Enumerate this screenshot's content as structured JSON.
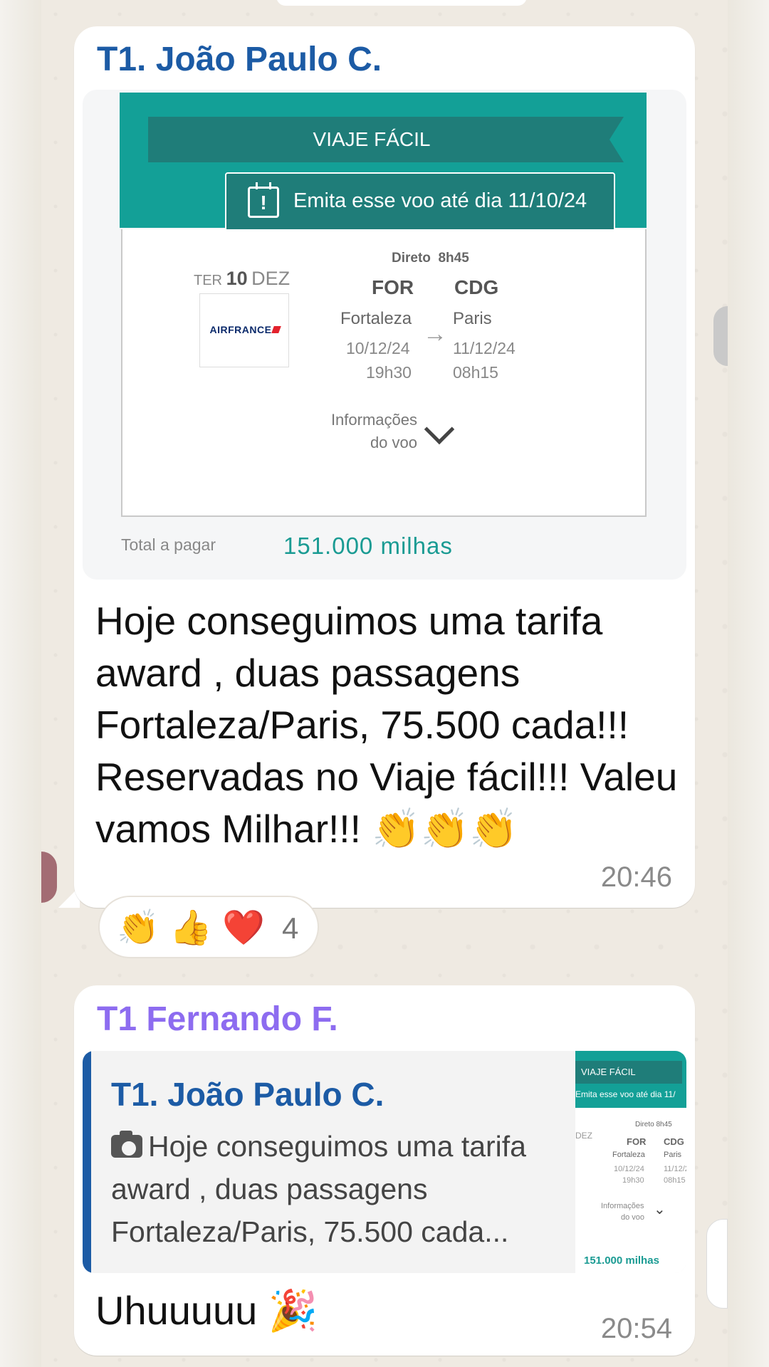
{
  "message1": {
    "sender": "T1. João Paulo C.",
    "image": {
      "banner_title": "VIAJE FÁCIL",
      "deadline": "Emita esse voo até dia 11/10/24",
      "weekday": "TER",
      "day": "10",
      "month": "DEZ",
      "airline": "AIRFRANCE",
      "flight_type": "Direto",
      "duration": "8h45",
      "from_code": "FOR",
      "to_code": "CDG",
      "from_city": "Fortaleza",
      "to_city": "Paris",
      "from_date": "10/12/24",
      "from_time": "19h30",
      "to_date": "11/12/24",
      "to_time": "08h15",
      "info_line1": "Informações",
      "info_line2": "do voo",
      "total_label": "Total a pagar",
      "total_value": "151.000 milhas"
    },
    "text": "Hoje conseguimos uma tarifa award , duas passagens Fortaleza/Paris, 75.500 cada!!! Reservadas no Viaje fácil!!! Valeu vamos Milhar!!! 👏👏👏",
    "time": "20:46",
    "reactions": [
      "👏",
      "👍",
      "❤️"
    ],
    "reaction_count": "4"
  },
  "message2": {
    "sender": "T1 Fernando F.",
    "quote": {
      "sender": "T1. João Paulo C.",
      "text": "Hoje conseguimos uma tarifa award , duas passagens Fortaleza/Paris, 75.500 cada...",
      "thumb": {
        "banner": "VIAJE FÁCIL",
        "deadline": "Emita esse voo até dia 11/",
        "month": "DEZ",
        "direct": "Direto 8h45",
        "from_code": "FOR",
        "to_code": "CDG",
        "from_city": "Fortaleza",
        "to_city": "Paris",
        "from_date": "10/12/24",
        "to_date": "11/12/2",
        "from_time": "19h30",
        "to_time": "08h15",
        "info1": "Informações",
        "info2": "do voo",
        "total": "151.000 milhas"
      }
    },
    "text": "Uhuuuuu 🎉",
    "time": "20:54"
  }
}
